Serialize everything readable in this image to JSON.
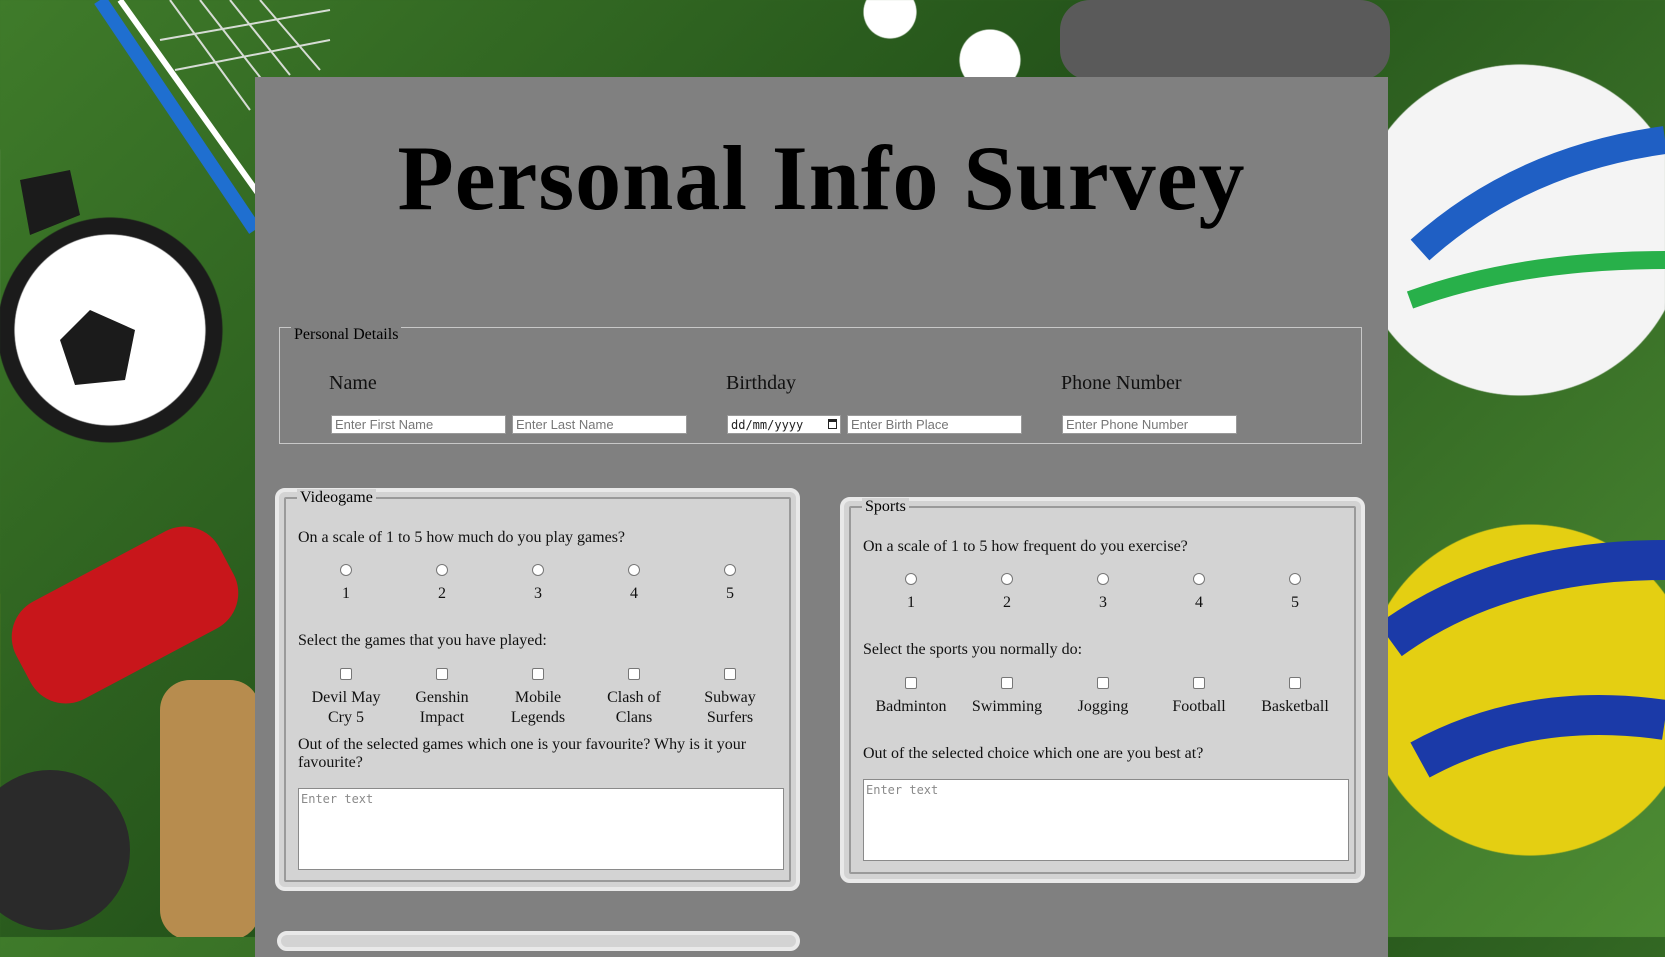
{
  "title": "Personal Info Survey",
  "personal": {
    "legend": "Personal Details",
    "name_label": "Name",
    "first_placeholder": "Enter First Name",
    "last_placeholder": "Enter Last Name",
    "birthday_label": "Birthday",
    "date_placeholder": "dd/mm/yyyy",
    "birthplace_placeholder": "Enter Birth Place",
    "phone_label": "Phone Number",
    "phone_placeholder": "Enter Phone Number"
  },
  "videogame": {
    "legend": "Videogame",
    "q1": "On a scale of 1 to 5 how much do you play games?",
    "scale": [
      "1",
      "2",
      "3",
      "4",
      "5"
    ],
    "q2": "Select the games that you have played:",
    "games": [
      "Devil May Cry 5",
      "Genshin Impact",
      "Mobile Legends",
      "Clash of Clans",
      "Subway Surfers"
    ],
    "q3": "Out of the selected games which one is your favourite? Why is it your favourite?",
    "text_placeholder": "Enter text"
  },
  "sports": {
    "legend": "Sports",
    "q1": "On a scale of 1 to 5 how frequent do you exercise?",
    "scale": [
      "1",
      "2",
      "3",
      "4",
      "5"
    ],
    "q2": "Select the sports you normally do:",
    "sports": [
      "Badminton",
      "Swimming",
      "Jogging",
      "Football",
      "Basketball"
    ],
    "q3": "Out of the selected choice which one are you best at?",
    "text_placeholder": "Enter text"
  },
  "colors": {
    "panel": "#808080",
    "card": "#d3d3d3",
    "grass": "#3f7b2a"
  }
}
